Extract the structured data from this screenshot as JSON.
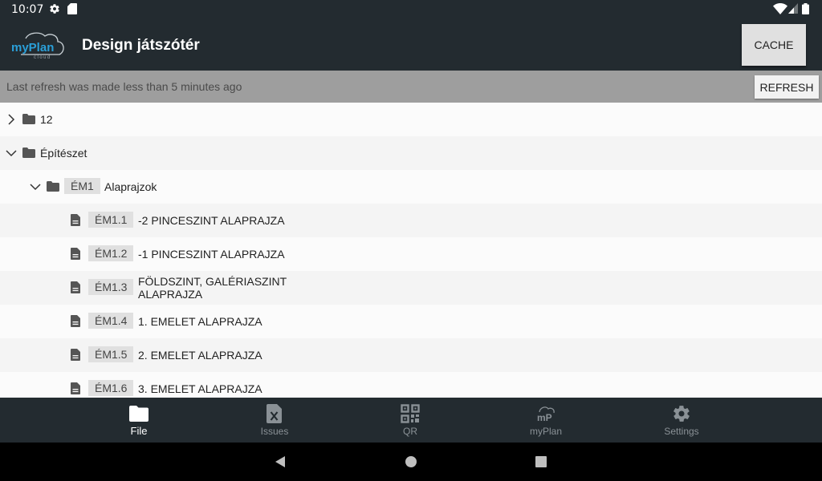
{
  "status": {
    "time": "10:07"
  },
  "app": {
    "logo_text": "myPlan",
    "logo_subtext": "cloud",
    "title": "Design játszótér",
    "cache_label": "CACHE"
  },
  "refresh": {
    "message": "Last refresh was made less than 5 minutes ago",
    "button_label": "REFRESH"
  },
  "tree": {
    "folders": [
      {
        "label": "12",
        "expanded": false
      },
      {
        "label": "Építészet",
        "expanded": true
      },
      {
        "code": "ÉM1",
        "label": "Alaprajzok",
        "expanded": true
      }
    ],
    "documents": [
      {
        "code": "ÉM1.1",
        "title": "-2 PINCESZINT ALAPRAJZA"
      },
      {
        "code": "ÉM1.2",
        "title": "-1 PINCESZINT ALAPRAJZA"
      },
      {
        "code": "ÉM1.3",
        "title_line1": "FÖLDSZINT, GALÉRIASZINT",
        "title_line2": "ALAPRAJZA"
      },
      {
        "code": "ÉM1.4",
        "title": "1. EMELET ALAPRAJZA"
      },
      {
        "code": "ÉM1.5",
        "title": "2. EMELET ALAPRAJZA"
      },
      {
        "code": "ÉM1.6",
        "title": "3. EMELET ALAPRAJZA"
      }
    ]
  },
  "nav": {
    "tabs": [
      {
        "label": "File",
        "icon": "folder-icon",
        "active": true
      },
      {
        "label": "Issues",
        "icon": "excel-file-icon",
        "active": false
      },
      {
        "label": "QR",
        "icon": "qr-code-icon",
        "active": false
      },
      {
        "label": "myPlan",
        "icon": "myplan-cloud-icon",
        "active": false
      },
      {
        "label": "Settings",
        "icon": "gear-icon",
        "active": false
      }
    ]
  },
  "colors": {
    "appbar": "#232b30",
    "refresh_bar": "#9e9e9e",
    "code_chip": "#e0e0e0",
    "active_tab": "#ffffff",
    "inactive_tab": "#8a9196"
  }
}
